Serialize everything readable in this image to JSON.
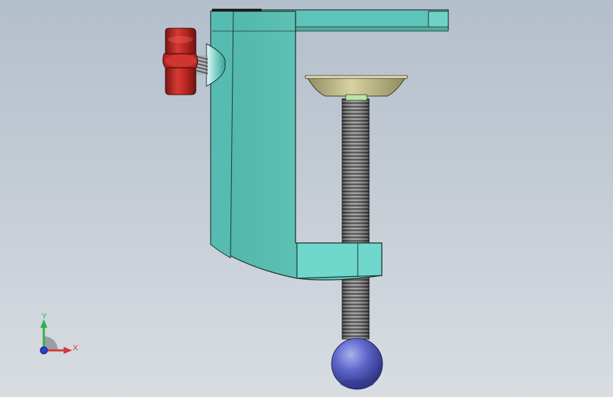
{
  "viewport": {
    "background_top": "#b4bfcc",
    "background_bottom": "#d8dde2"
  },
  "model": {
    "parts": [
      {
        "name": "clamp-frame",
        "color": "#5cc3b8"
      },
      {
        "name": "red-knob",
        "color": "#c42a25"
      },
      {
        "name": "pressure-pad",
        "color": "#c9c28f"
      },
      {
        "name": "threaded-screw",
        "color": "#6b6b6b"
      },
      {
        "name": "ball-handle",
        "color": "#5a63c6"
      }
    ]
  },
  "triad": {
    "y_label": "Y",
    "x_label": "X",
    "y_color": "#2bb24a",
    "x_color": "#d23a3a",
    "z_color": "#2a3fd6"
  }
}
